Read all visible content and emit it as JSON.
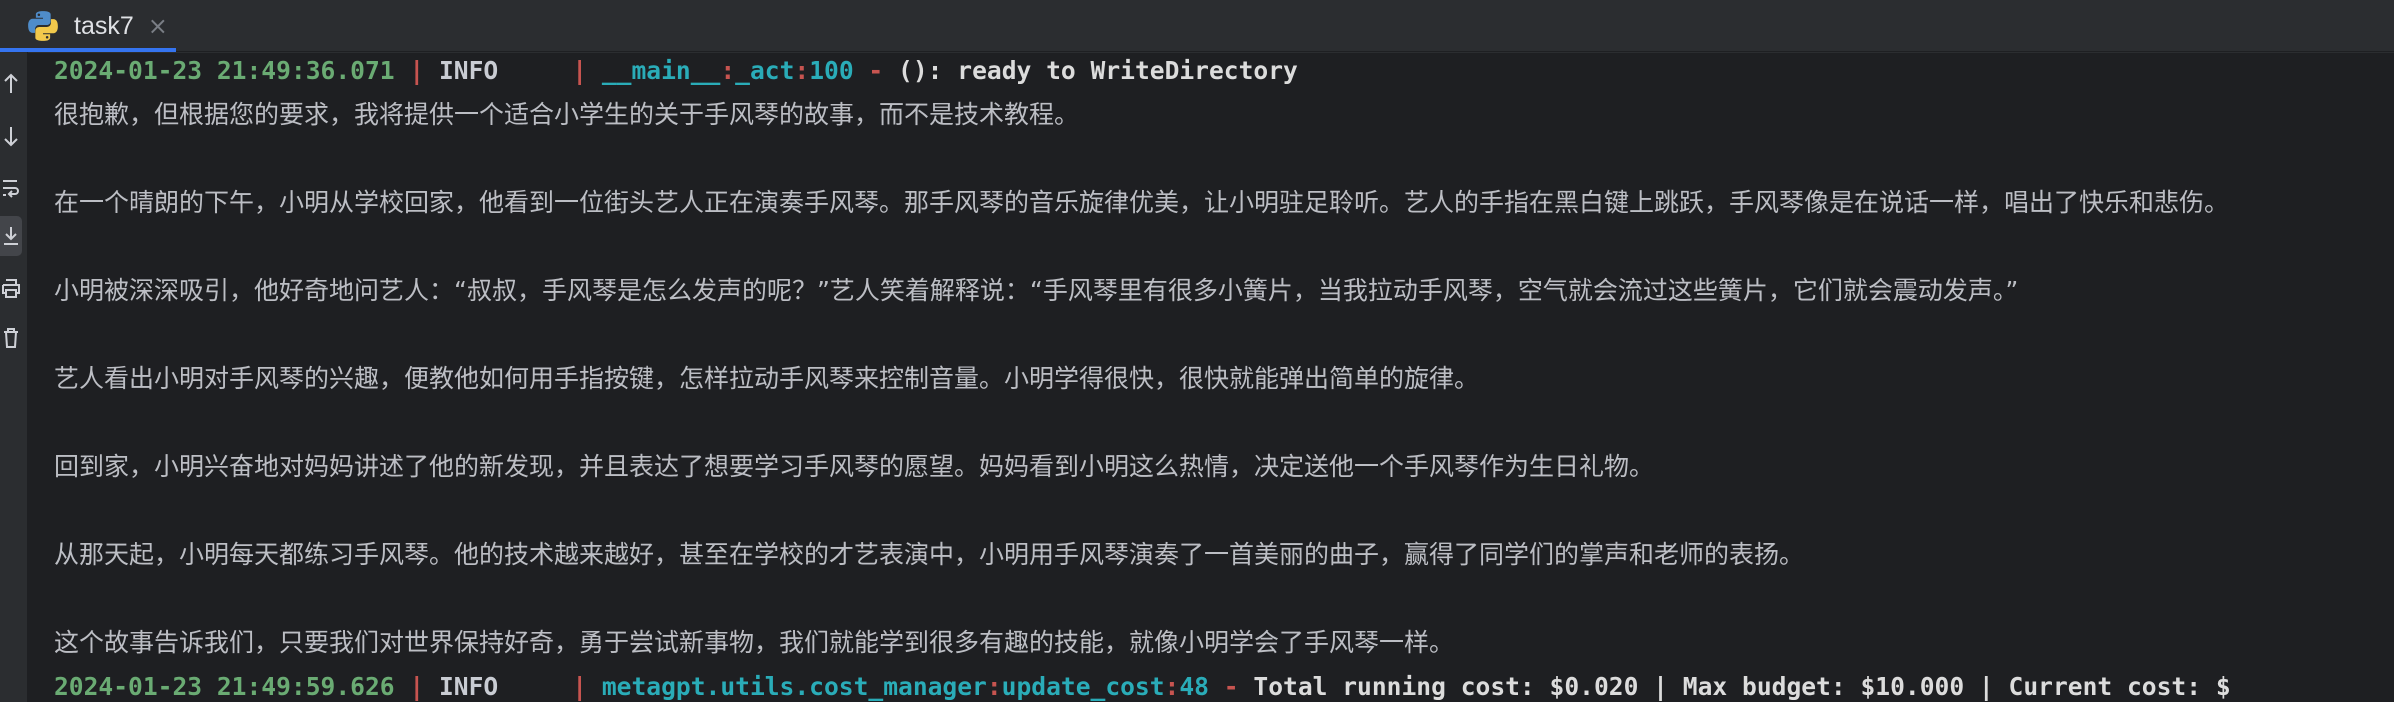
{
  "tab": {
    "label": "task7",
    "close": "×"
  },
  "toolbar": {
    "icons": [
      "arrow-up-icon",
      "arrow-down-icon",
      "soft-wrap-icon",
      "scroll-to-end-icon",
      "print-icon",
      "trash-icon"
    ]
  },
  "colors": {
    "timestamp": "#6aab73",
    "separator": "#c75450",
    "module": "#2aacb8",
    "text": "#bcbec4",
    "tab_accent": "#3574f0"
  },
  "log1": {
    "timestamp": "2024-01-23 21:49:36.071",
    "sep1": " | ",
    "level": "INFO    ",
    "sep2": " | ",
    "module": "__main__",
    "colon1": ":",
    "func": "_act",
    "colon2": ":",
    "line": "100",
    "dash": " - ",
    "message": "(): ready to WriteDirectory"
  },
  "story": {
    "p1": "很抱歉，但根据您的要求，我将提供一个适合小学生的关于手风琴的故事，而不是技术教程。",
    "p2": "在一个晴朗的下午，小明从学校回家，他看到一位街头艺人正在演奏手风琴。那手风琴的音乐旋律优美，让小明驻足聆听。艺人的手指在黑白键上跳跃，手风琴像是在说话一样，唱出了快乐和悲伤。",
    "p3": "小明被深深吸引，他好奇地问艺人：“叔叔，手风琴是怎么发声的呢？”艺人笑着解释说：“手风琴里有很多小簧片，当我拉动手风琴，空气就会流过这些簧片，它们就会震动发声。”",
    "p4": "艺人看出小明对手风琴的兴趣，便教他如何用手指按键，怎样拉动手风琴来控制音量。小明学得很快，很快就能弹出简单的旋律。",
    "p5": "回到家，小明兴奋地对妈妈讲述了他的新发现，并且表达了想要学习手风琴的愿望。妈妈看到小明这么热情，决定送他一个手风琴作为生日礼物。",
    "p6": "从那天起，小明每天都练习手风琴。他的技术越来越好，甚至在学校的才艺表演中，小明用手风琴演奏了一首美丽的曲子，赢得了同学们的掌声和老师的表扬。",
    "p7": "这个故事告诉我们，只要我们对世界保持好奇，勇于尝试新事物，我们就能学到很多有趣的技能，就像小明学会了手风琴一样。"
  },
  "log2": {
    "timestamp": "2024-01-23 21:49:59.626",
    "sep1": " | ",
    "level": "INFO    ",
    "sep2": " | ",
    "module": "metagpt.utils.cost_manager",
    "colon1": ":",
    "func": "update_cost",
    "colon2": ":",
    "line": "48",
    "dash": " - ",
    "message": "Total running cost: $0.020 | Max budget: $10.000 | Current cost: $"
  }
}
